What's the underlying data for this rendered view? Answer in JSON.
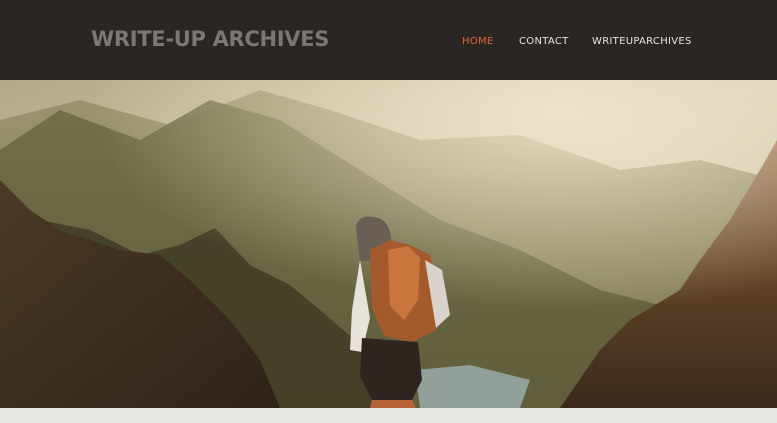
{
  "header": {
    "site_title": "WRITE-UP ARCHIVES",
    "nav": [
      {
        "label": "HOME",
        "active": true
      },
      {
        "label": "CONTACT",
        "active": false
      },
      {
        "label": "WRITEUPARCHIVES",
        "active": false
      }
    ]
  },
  "hero": {
    "image": "mountain-hiker-photo"
  },
  "colors": {
    "header_bg": "#2b2523",
    "accent": "#d86a34",
    "title": "#7c7775",
    "nav_text": "#e8e3df"
  }
}
